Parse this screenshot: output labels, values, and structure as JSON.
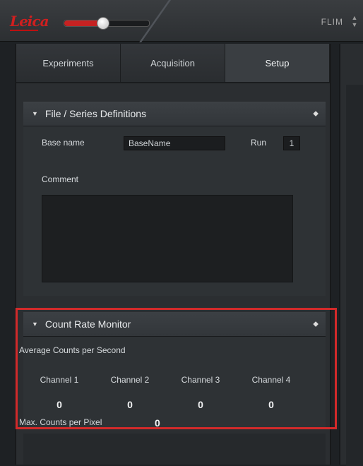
{
  "app": {
    "logo_text": "Leica",
    "mode_label": "FLIM"
  },
  "tabs": [
    {
      "label": "Experiments",
      "active": false
    },
    {
      "label": "Acquisition",
      "active": false
    },
    {
      "label": "Setup",
      "active": true
    }
  ],
  "file_section": {
    "title": "File / Series Definitions",
    "base_name_label": "Base name",
    "base_name_value": "BaseName",
    "run_label": "Run",
    "run_value": "1",
    "comment_label": "Comment",
    "comment_value": ""
  },
  "count_rate": {
    "title": "Count Rate Monitor",
    "avg_label": "Average Counts per Second",
    "channels": [
      {
        "label": "Channel 1",
        "value": "0"
      },
      {
        "label": "Channel 2",
        "value": "0"
      },
      {
        "label": "Channel 3",
        "value": "0"
      },
      {
        "label": "Channel 4",
        "value": "0"
      }
    ],
    "max_label": "Max. Counts per Pixel",
    "max_value": "0"
  },
  "colors": {
    "accent": "#d22a2a",
    "panel": "#2b2e31",
    "header": "#3a3e42"
  }
}
